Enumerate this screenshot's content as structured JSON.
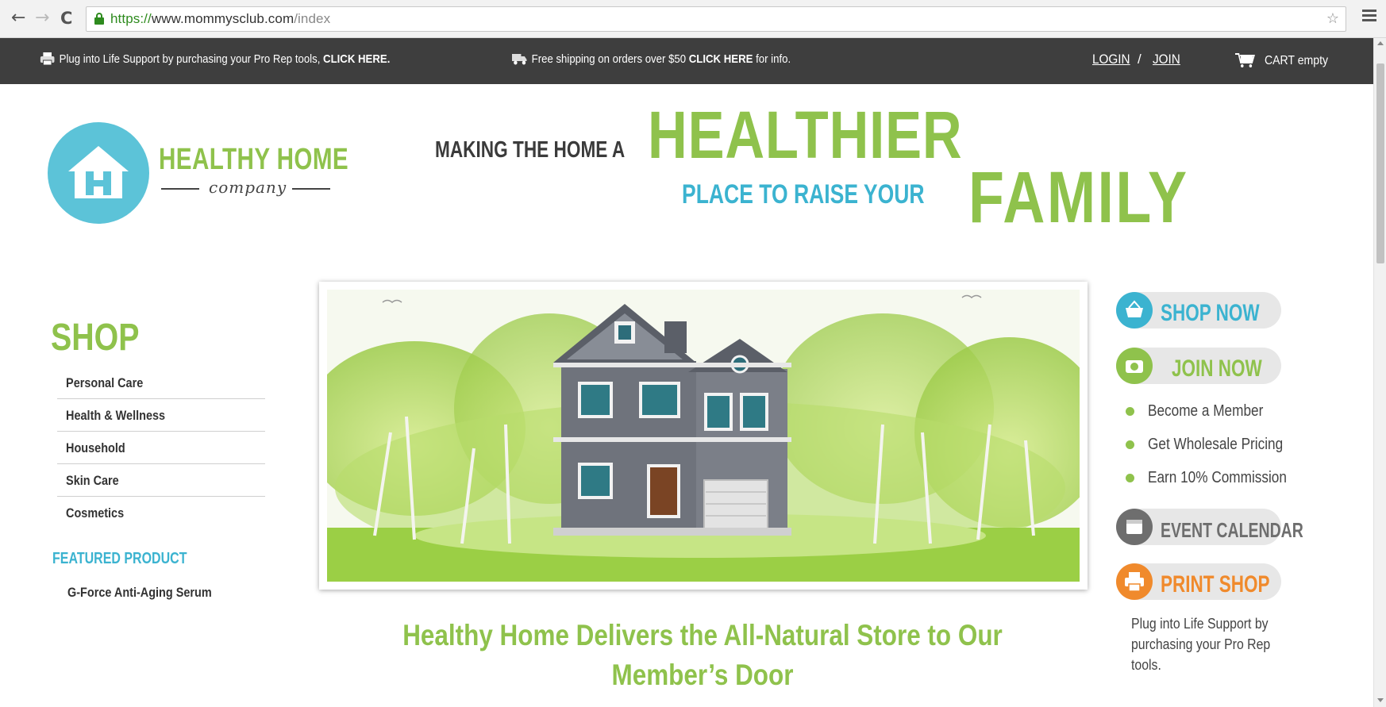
{
  "browser": {
    "url_scheme": "https://",
    "url_host": "www.mommysclub.com",
    "url_path": "/index",
    "back_icon": "←",
    "forward_icon": "→",
    "reload_icon": "C"
  },
  "topbar": {
    "promo1_text": "Plug into Life Support by purchasing your Pro Rep tools, ",
    "promo1_link": "CLICK HERE.",
    "promo2_text": "Free shipping on orders over $50 ",
    "promo2_link": "CLICK HERE",
    "promo2_suffix": " for info.",
    "login": "LOGIN",
    "separator": "/",
    "join": "JOIN",
    "cart": "CART empty"
  },
  "logo": {
    "name": "HEALTHY HOME",
    "sub": "company"
  },
  "tagline": {
    "line1": "MAKING THE HOME A",
    "big1": "HEALTHIER",
    "line2": "PLACE TO RAISE YOUR",
    "big2": "FAMILY"
  },
  "shop": {
    "heading": "SHOP",
    "items": [
      {
        "label": "Personal Care"
      },
      {
        "label": "Health & Wellness"
      },
      {
        "label": "Household"
      },
      {
        "label": "Skin Care"
      },
      {
        "label": "Cosmetics"
      }
    ],
    "featured_heading": "FEATURED PRODUCT",
    "featured_item": "G-Force Anti-Aging Serum"
  },
  "main": {
    "caption": "Healthy Home Delivers the All-Natural Store to Our Member’s Door"
  },
  "sidebar_right": {
    "shop_now": "SHOP NOW",
    "join_now": "JOIN NOW",
    "benefits": [
      {
        "label": "Become a Member"
      },
      {
        "label": "Get Wholesale Pricing"
      },
      {
        "label": "Earn 10% Commission"
      }
    ],
    "event_calendar": "EVENT CALENDAR",
    "print_shop": "PRINT SHOP",
    "print_note": "Plug into Life Support by purchasing your Pro Rep tools."
  },
  "colors": {
    "green": "#8fc24c",
    "blue": "#3bb3d0",
    "gray": "#6e6e6e",
    "orange": "#f08a2c",
    "topbar": "#3e3e3e"
  },
  "icons": {
    "printer": "printer-icon",
    "truck": "truck-icon",
    "cart": "cart-icon",
    "basket": "basket-icon",
    "camera": "camera-icon",
    "calendar": "calendar-icon",
    "print": "printer-icon"
  }
}
